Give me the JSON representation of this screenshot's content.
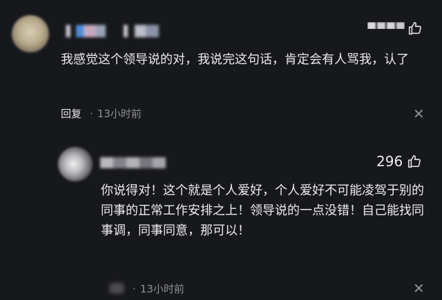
{
  "comments": [
    {
      "text": "我感觉这个领导说的对，我说完这句话，肯定会有人骂我，认了",
      "reply_label": "回复",
      "separator": "·",
      "time": "13小时前",
      "like_icon": "thumbs-up-icon",
      "close_icon": "close-icon"
    },
    {
      "text": "你说得对！这个就是个人爱好，个人爱好不可能凌驾于别的同事的正常工作安排之上！领导说的一点没错！自己能找同事调，同事同意，那可以！",
      "likes": "296",
      "separator": "·",
      "time": "13小时前",
      "like_icon": "thumbs-up-icon",
      "close_icon": "close-icon"
    }
  ]
}
